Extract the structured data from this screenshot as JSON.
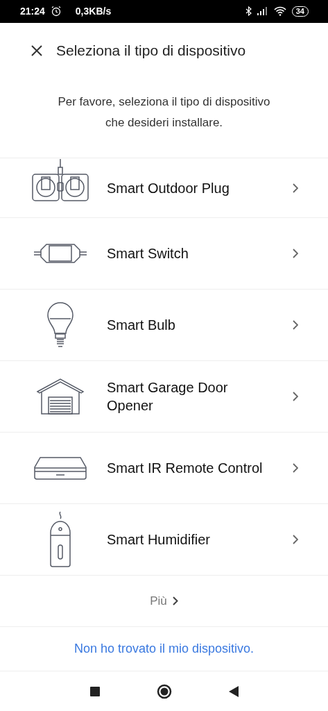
{
  "status_bar": {
    "time": "21:24",
    "speed": "0,3KB/s",
    "battery": "34"
  },
  "header": {
    "title": "Seleziona il tipo di dispositivo"
  },
  "instructions": "Per favore, seleziona il tipo di dispositivo che desideri installare.",
  "devices": [
    {
      "kind": "outdoor-plug",
      "label": "Smart Outdoor Plug"
    },
    {
      "kind": "switch",
      "label": "Smart Switch"
    },
    {
      "kind": "bulb",
      "label": "Smart Bulb"
    },
    {
      "kind": "garage",
      "label": "Smart Garage Door Opener"
    },
    {
      "kind": "ir-remote",
      "label": "Smart IR Remote Control"
    },
    {
      "kind": "humidifier",
      "label": "Smart Humidifier"
    }
  ],
  "more": "Più",
  "not_found_link": "Non ho trovato il mio dispositivo."
}
